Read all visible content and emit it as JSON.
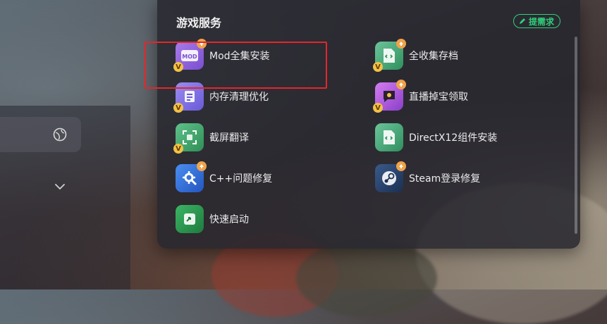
{
  "panel": {
    "title": "游戏服务",
    "request_button": "提需求"
  },
  "items_left": [
    {
      "label": "Mod全集安装",
      "icon": "mod-icon",
      "color": "#8b5fd8"
    },
    {
      "label": "内存清理优化",
      "icon": "memory-clean-icon",
      "color": "#7b6be0"
    },
    {
      "label": "截屏翻译",
      "icon": "screenshot-translate-icon",
      "color": "#3fa86b"
    },
    {
      "label": "C++问题修复",
      "icon": "cpp-repair-icon",
      "color": "#2f6fd6"
    },
    {
      "label": "快速启动",
      "icon": "quick-launch-icon",
      "color": "#2c9a4c"
    }
  ],
  "items_right": [
    {
      "label": "全收集存档",
      "icon": "save-collection-icon",
      "color": "#3fa86b"
    },
    {
      "label": "直播掉宝领取",
      "icon": "live-drop-icon",
      "color": "#c25fd8"
    },
    {
      "label": "DirectX12组件安装",
      "icon": "directx-icon",
      "color": "#3fa86b"
    },
    {
      "label": "Steam登录修复",
      "icon": "steam-repair-icon",
      "color": "#2a4a7a"
    }
  ],
  "colors": {
    "accent_green": "#2fd07c",
    "highlight_red": "#e4262b",
    "badge_yellow": "#f2c247"
  }
}
